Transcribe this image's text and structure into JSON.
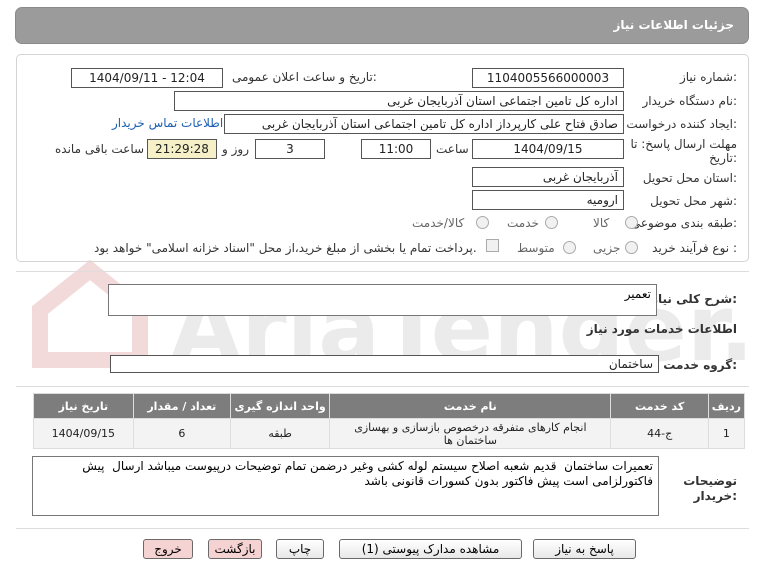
{
  "page": {
    "title": "جزئیات اطلاعات نیاز"
  },
  "fields": {
    "need_number_label": "شماره نیاز:",
    "need_number": "1104005566000003",
    "announce_label": "تاریخ و ساعت اعلان عمومی:",
    "announce_value": "1404/09/11 - 12:04",
    "buyer_org_label": "نام دستگاه خریدار:",
    "buyer_org": "اداره کل تامین اجتماعی استان آذربایجان غربی",
    "requester_label": "ایجاد کننده درخواست:",
    "requester": "صادق فتاح علی کارپرداز اداره کل تامین اجتماعی استان آذربایجان غربی",
    "contact_link": "اطلاعات تماس خریدار",
    "deadline_label_1": "مهلت ارسال پاسخ: تا",
    "deadline_label_2": "تاریخ:",
    "deadline_date": "1404/09/15",
    "time_label": "ساعت",
    "deadline_time": "11:00",
    "days_value": "3",
    "days_label": "روز و",
    "remaining_time": "21:29:28",
    "remaining_label": "ساعت باقی مانده",
    "province_label": "استان محل تحویل:",
    "province": "آذربایجان غربی",
    "city_label": "شهر محل تحویل:",
    "city": "ارومیه",
    "category_label": "طبقه بندی موضوعی:",
    "category_options": [
      "کالا",
      "خدمت",
      "کالا/خدمت"
    ],
    "process_label": "نوع فرآیند خرید :",
    "process_options": [
      "جزیی",
      "متوسط"
    ],
    "payment_note": "پرداخت تمام یا بخشی از مبلغ خرید،از محل \"اسناد خزانه اسلامی\" خواهد بود."
  },
  "summary": {
    "label": "شرح کلی نیاز:",
    "value": "تعمیر"
  },
  "services": {
    "section_title": "اطلاعات خدمات مورد نیاز",
    "group_label": "گروه خدمت:",
    "group_value": "ساختمان",
    "table": {
      "headers": [
        "ردیف",
        "کد خدمت",
        "نام خدمت",
        "واحد اندازه گیری",
        "تعداد / مقدار",
        "تاریخ نیاز"
      ],
      "rows": [
        [
          "1",
          "ج-44",
          "انجام کارهای متفرقه درخصوص بازسازی و بهسازی ساختمان ها",
          "طبقه",
          "6",
          "1404/09/15"
        ]
      ]
    }
  },
  "buyer_notes": {
    "label_1": "توضیحات",
    "label_2": "خریدار:",
    "value": "تعمیرات ساختمان  قدیم شعبه اصلاح سیستم لوله کشی وغیر درضمن تمام توضیحات درپیوست میباشد ارسال  پیش فاکتورلزامی است پیش فاکتور بدون کسورات قانونی باشد"
  },
  "buttons": {
    "reply": "پاسخ به نیاز",
    "attachments": "مشاهده مدارک پیوستی (1)",
    "print": "چاپ",
    "back": "بازگشت",
    "exit": "خروج"
  },
  "colors": {
    "header_bg": "#9b9b9b",
    "table_header_bg": "#7d7d7d",
    "link": "#1d5fb3",
    "exit_btn": "#f6d3d3"
  }
}
